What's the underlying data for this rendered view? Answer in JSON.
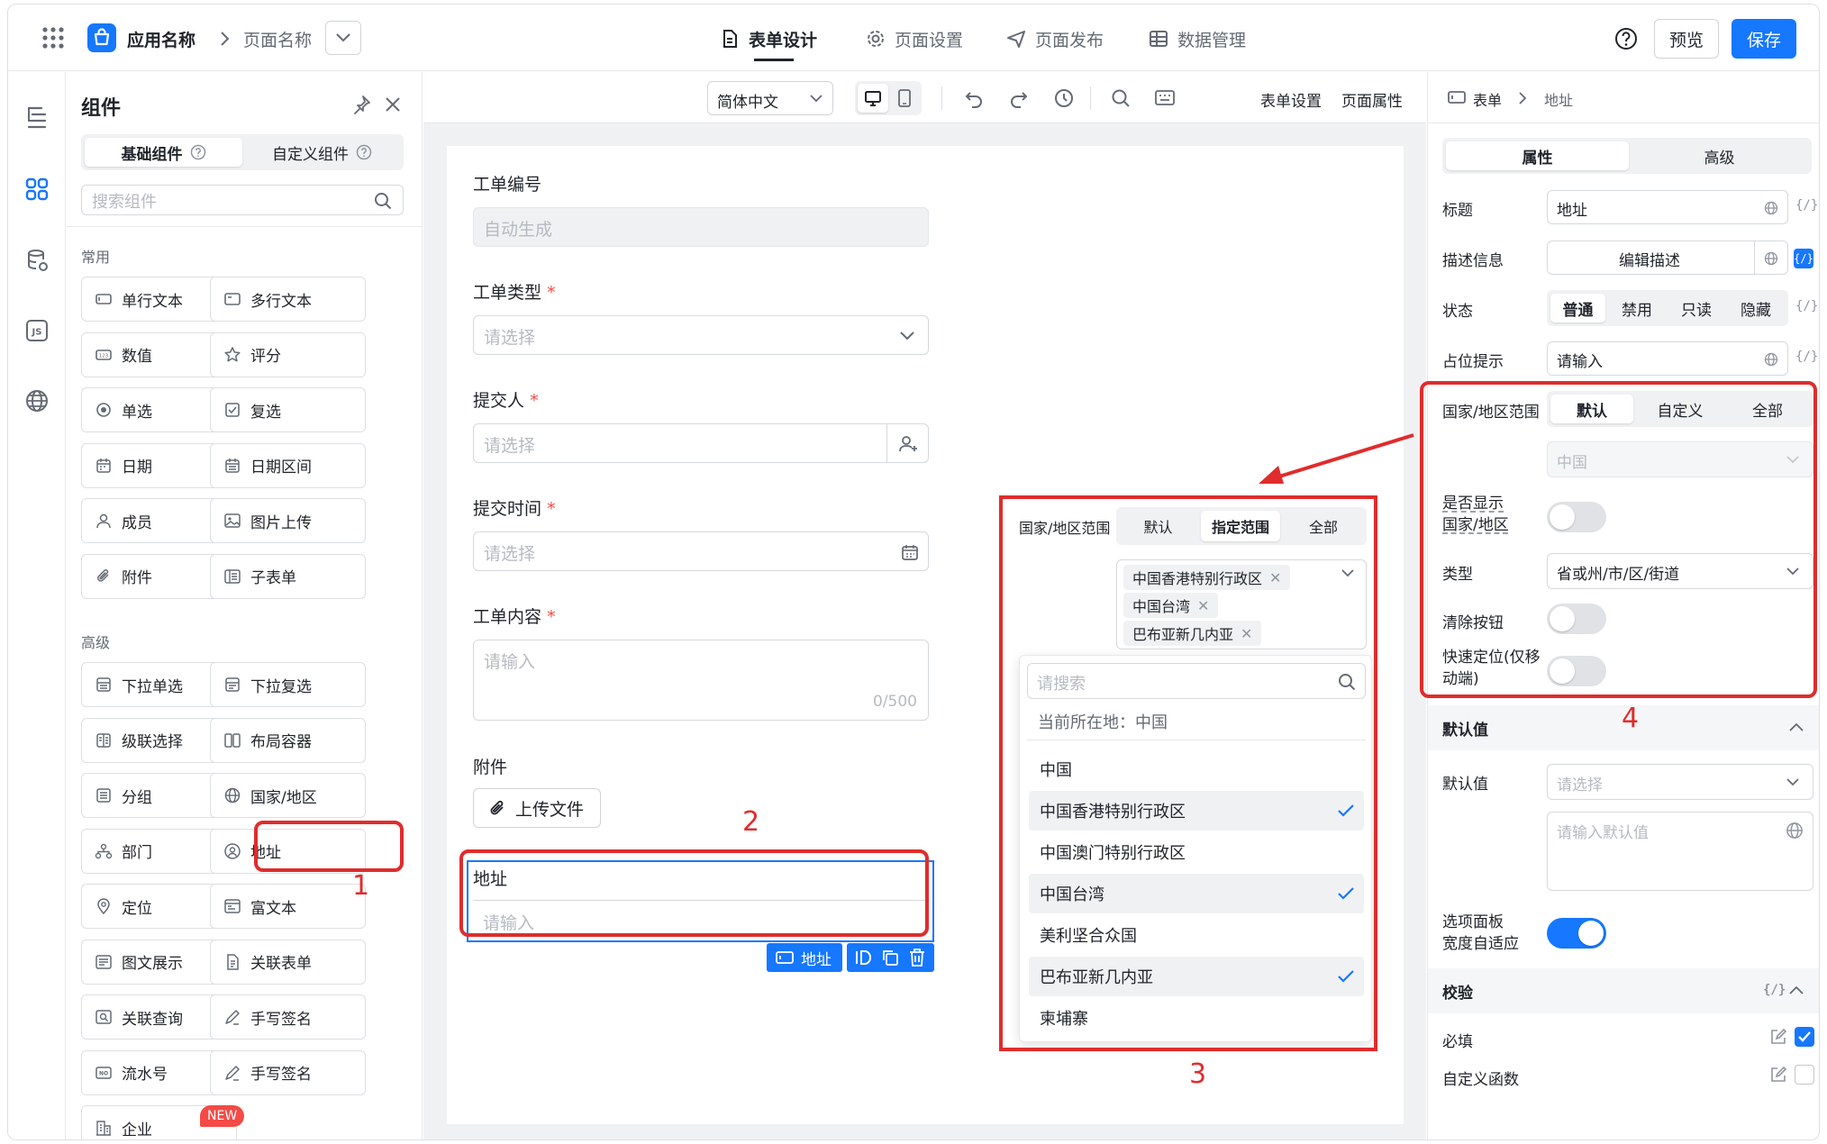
{
  "header": {
    "app_name": "应用名称",
    "page_name": "页面名称",
    "tabs": [
      {
        "label": "表单设计",
        "active": true
      },
      {
        "label": "页面设置"
      },
      {
        "label": "页面发布"
      },
      {
        "label": "数据管理"
      }
    ],
    "preview_label": "预览",
    "save_label": "保存"
  },
  "left_panel": {
    "title": "组件",
    "tabs": [
      "基础组件",
      "自定义组件"
    ],
    "search_placeholder": "搜索组件",
    "section_common": "常用",
    "common": [
      "单行文本",
      "多行文本",
      "数值",
      "评分",
      "单选",
      "复选",
      "日期",
      "日期区间",
      "成员",
      "图片上传",
      "附件",
      "子表单"
    ],
    "section_advanced": "高级",
    "advanced": [
      "下拉单选",
      "下拉复选",
      "级联选择",
      "布局容器",
      "分组",
      "国家/地区",
      "部门",
      "地址",
      "定位",
      "富文本",
      "图文展示",
      "关联表单",
      "关联查询",
      "手写签名",
      "流水号",
      "手写签名",
      "企业"
    ],
    "new_badge": "NEW"
  },
  "toolbar": {
    "language": "简体中文",
    "form_settings": "表单设置",
    "page_props": "页面属性"
  },
  "form": {
    "ticket_no_label": "工单编号",
    "ticket_no_value": "自动生成",
    "ticket_type_label": "工单类型",
    "ticket_type_ph": "请选择",
    "submitter_label": "提交人",
    "submitter_ph": "请选择",
    "submit_time_label": "提交时间",
    "submit_time_ph": "请选择",
    "content_label": "工单内容",
    "content_ph": "请输入",
    "content_count": "0/500",
    "attach_label": "附件",
    "upload_label": "上传文件",
    "address_label": "地址",
    "address_ph": "请输入",
    "address_badge": "地址",
    "required_mark": "*"
  },
  "popover": {
    "range_label": "国家/地区范围",
    "range_tabs": [
      "默认",
      "指定范围",
      "全部"
    ],
    "tags": [
      "中国香港特别行政区",
      "中国台湾",
      "巴布亚新几内亚"
    ],
    "search_ph": "请搜索",
    "current": "当前所在地：中国",
    "options": [
      {
        "label": "中国",
        "checked": false
      },
      {
        "label": "中国香港特别行政区",
        "checked": true
      },
      {
        "label": "中国澳门特别行政区",
        "checked": false
      },
      {
        "label": "中国台湾",
        "checked": true
      },
      {
        "label": "美利坚合众国",
        "checked": false
      },
      {
        "label": "巴布亚新几内亚",
        "checked": true
      },
      {
        "label": "柬埔寨",
        "checked": false
      }
    ]
  },
  "right_panel": {
    "breadcrumb_root": "表单",
    "breadcrumb_leaf": "地址",
    "tabs": [
      "属性",
      "高级"
    ],
    "title_label": "标题",
    "title_value": "地址",
    "desc_label": "描述信息",
    "desc_button": "编辑描述",
    "status_label": "状态",
    "status_options": [
      "普通",
      "禁用",
      "只读",
      "隐藏"
    ],
    "placeholder_label": "占位提示",
    "placeholder_value": "请输入",
    "range_label": "国家/地区范围",
    "range_options": [
      "默认",
      "自定义",
      "全部"
    ],
    "range_value": "中国",
    "show_country_label_1": "是否显示",
    "show_country_label_2": "国家/地区",
    "type_label": "类型",
    "type_value": "省或州/市/区/街道",
    "clear_label": "清除按钮",
    "quick_locate_label_1": "快速定位(仅移",
    "quick_locate_label_2": "动端)",
    "default_section": "默认值",
    "default_label": "默认值",
    "default_select_ph": "请选择",
    "default_input_ph": "请输入默认值",
    "adaptive_label_1": "选项面板",
    "adaptive_label_2": "宽度自适应",
    "validate_section": "校验",
    "required_label": "必填",
    "custom_fn_label": "自定义函数"
  },
  "annotations": [
    "1",
    "2",
    "3",
    "4"
  ]
}
